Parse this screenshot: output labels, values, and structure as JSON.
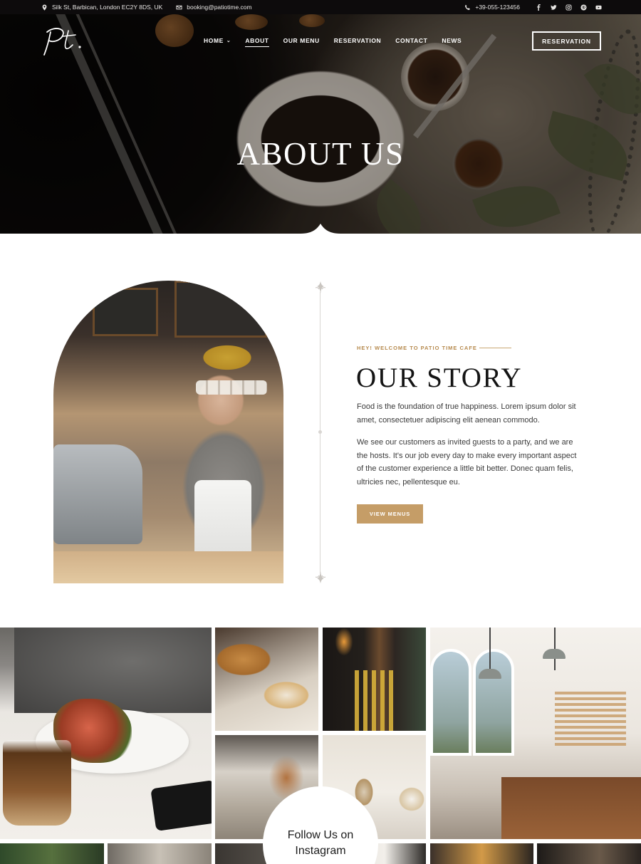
{
  "topbar": {
    "address": "Silk St, Barbican, London EC2Y 8DS, UK",
    "email": "booking@patiotime.com",
    "phone": "+39-055-123456",
    "social_icons": [
      "facebook-icon",
      "twitter-icon",
      "instagram-icon",
      "pinterest-icon",
      "youtube-icon"
    ]
  },
  "header": {
    "logo_text": "Pt.",
    "nav": [
      {
        "label": "HOME",
        "has_dropdown": true,
        "active": false
      },
      {
        "label": "ABOUT",
        "active": true
      },
      {
        "label": "OUR MENU",
        "active": false
      },
      {
        "label": "RESERVATION",
        "active": false
      },
      {
        "label": "CONTACT",
        "active": false
      },
      {
        "label": "NEWS",
        "active": false
      }
    ],
    "cta_label": "RESERVATION"
  },
  "hero": {
    "title": "ABOUT US"
  },
  "story": {
    "eyebrow": "HEY! WELCOME TO PATIO TIME CAFE",
    "title": "OUR STORY",
    "paragraph_1": "Food is the foundation of true happiness. Lorem ipsum dolor sit amet, consectetuer adipiscing elit aenean commodo.",
    "paragraph_2": "We see our customers as invited guests to a party, and we are the hosts. It's our job every day to make every important aspect of the customer experience a little bit better. Donec quam felis, ultricies nec, pellentesque eu.",
    "button_label": "VIEW MENUS"
  },
  "instagram": {
    "follow_line_1": "Follow Us on",
    "follow_line_2": "Instagram"
  },
  "colors": {
    "accent": "#c59d67",
    "eyebrow": "#b68a4e",
    "topbar_bg": "#0d0b0c",
    "heading": "#141414"
  }
}
